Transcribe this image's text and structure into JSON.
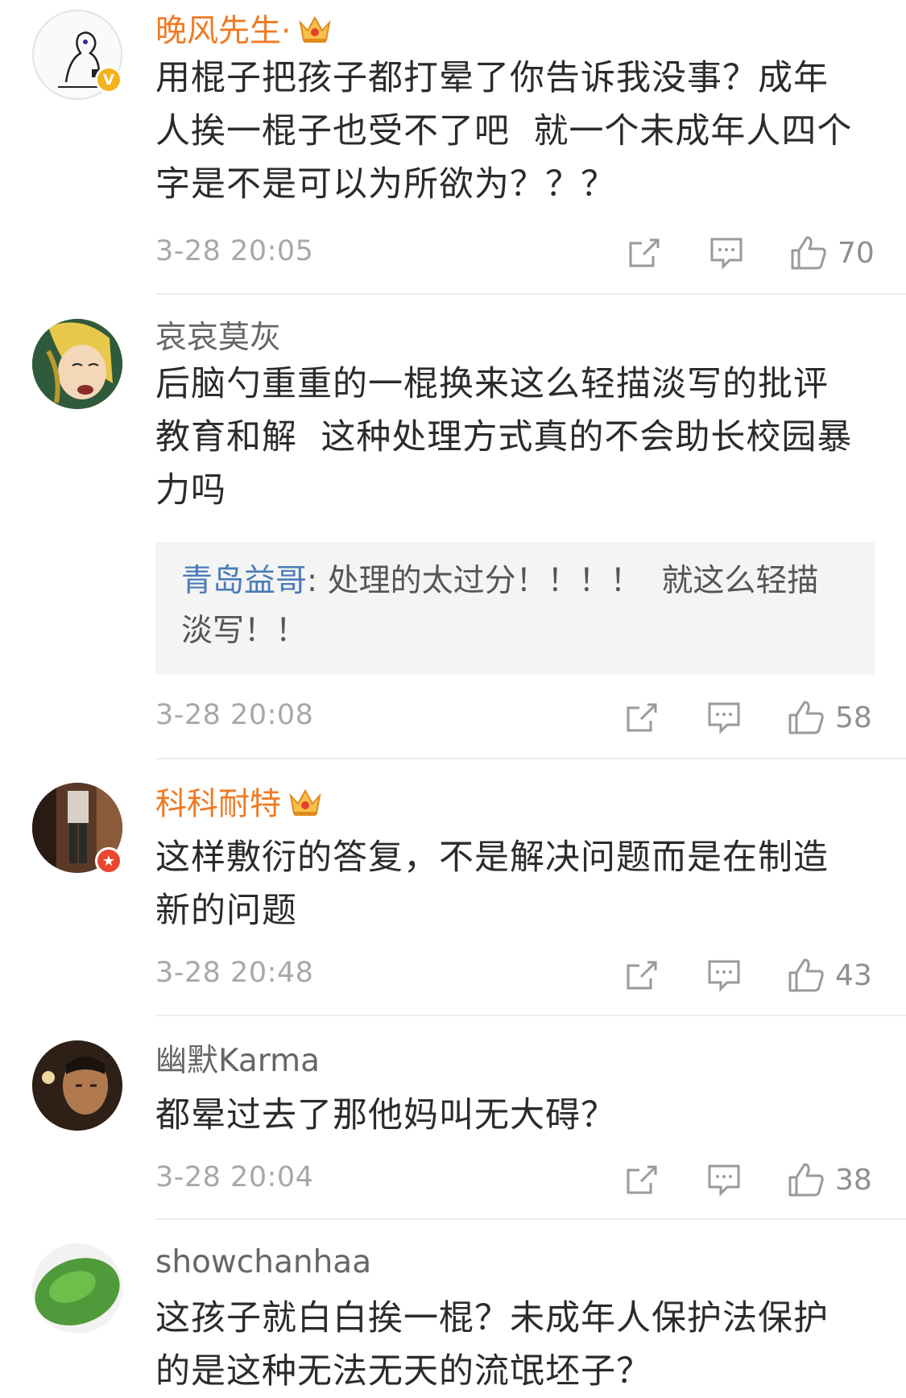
{
  "comments": [
    {
      "username": "晚风先生·",
      "text_lines": [
        "用棍子把孩子都打晕了你告诉我没事？成年",
        "人挨一棍子也受不了吧  就一个未成年人四个",
        "字是不是可以为所欲为？？？"
      ],
      "time": "3-28 20:05",
      "likes": "70",
      "badge": "V"
    },
    {
      "username": "哀哀莫灰",
      "text_lines": [
        "后脑勺重重的一棍换来这么轻描淡写的批评",
        "教育和解  这种处理方式真的不会助长校园暴",
        "力吗"
      ],
      "reply": {
        "name": "青岛益哥",
        "sep": ": ",
        "text_lines": [
          "处理的太过分！！！！  就这么轻描",
          "淡写！！"
        ]
      },
      "time": "3-28 20:08",
      "likes": "58"
    },
    {
      "username": "科科耐特",
      "text_lines": [
        "这样敷衍的答复，不是解决问题而是在制造",
        "新的问题"
      ],
      "time": "3-28 20:48",
      "likes": "43",
      "badge": "★"
    },
    {
      "username": "幽默Karma",
      "text_lines": [
        "都晕过去了那他妈叫无大碍？"
      ],
      "time": "3-28 20:04",
      "likes": "38"
    },
    {
      "username": "showchanhaa",
      "text_lines": [
        "这孩子就白白挨一棍？未成年人保护法保护",
        "的是这种无法无天的流氓坯子？"
      ]
    }
  ],
  "icons": {
    "share": "share-icon",
    "reply": "comment-icon",
    "like": "thumbs-up-icon",
    "crown": "crown-icon"
  },
  "colors": {
    "vip_name": "#ef7a23",
    "reply_name": "#4a7bb8",
    "verified_badge": "#f5b21c",
    "star_badge": "#e8472d"
  }
}
